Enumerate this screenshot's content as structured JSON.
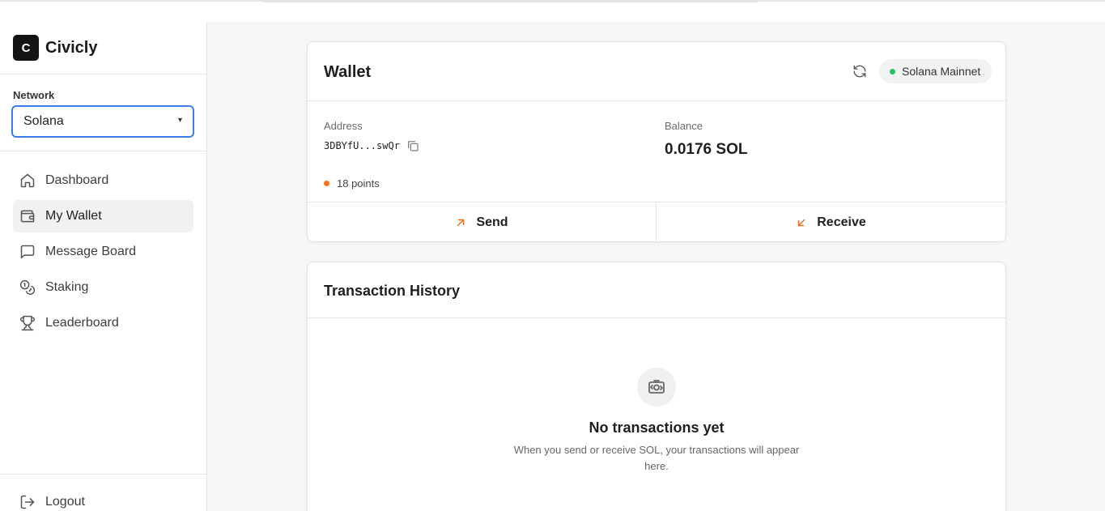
{
  "brand": {
    "logo_letter": "C",
    "name": "Civicly"
  },
  "network": {
    "label": "Network",
    "selected": "Solana"
  },
  "nav": {
    "items": [
      {
        "label": "Dashboard",
        "icon": "home-icon",
        "active": false
      },
      {
        "label": "My Wallet",
        "icon": "wallet-icon",
        "active": true
      },
      {
        "label": "Message Board",
        "icon": "message-icon",
        "active": false
      },
      {
        "label": "Staking",
        "icon": "coins-icon",
        "active": false
      },
      {
        "label": "Leaderboard",
        "icon": "trophy-icon",
        "active": false
      }
    ],
    "logout": "Logout"
  },
  "wallet": {
    "title": "Wallet",
    "network_badge": "Solana Mainnet",
    "address_label": "Address",
    "address": "3DBYfU...swQr",
    "balance_label": "Balance",
    "balance": "0.0176 SOL",
    "points": "18 points",
    "send_label": "Send",
    "receive_label": "Receive"
  },
  "history": {
    "title": "Transaction History",
    "empty_title": "No transactions yet",
    "empty_desc": "When you send or receive SOL, your transactions will appear here."
  },
  "colors": {
    "accent": "#3b7cf0",
    "status_green": "#22c55e",
    "points_orange": "#f97316",
    "action_orange": "#ea6d1f"
  }
}
